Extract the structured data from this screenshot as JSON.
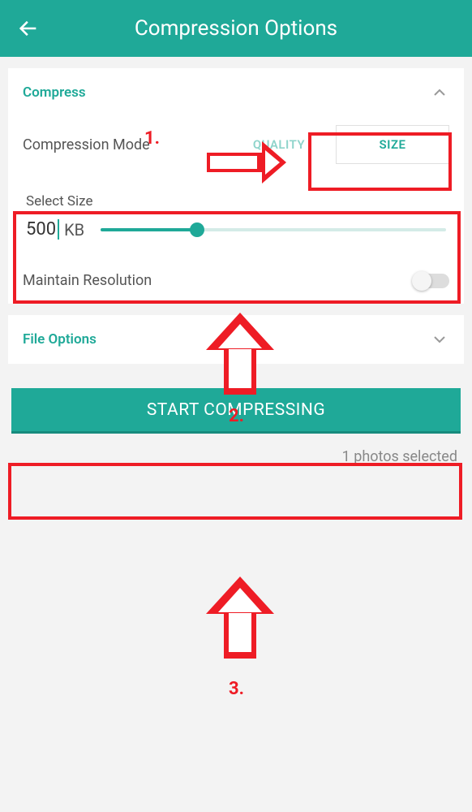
{
  "header": {
    "title": "Compression Options"
  },
  "compress": {
    "title": "Compress",
    "mode_label": "Compression Mode",
    "quality_label": "QUALITY",
    "size_label": "SIZE",
    "select_size_label": "Select Size",
    "size_value": "500",
    "size_unit": "KB",
    "maintain_label": "Maintain Resolution"
  },
  "file_options": {
    "title": "File Options"
  },
  "action": {
    "start_label": "START COMPRESSING",
    "photos_selected": "1 photos selected"
  },
  "annotations": {
    "label1": "1.",
    "label2": "2.",
    "label3": "3."
  }
}
